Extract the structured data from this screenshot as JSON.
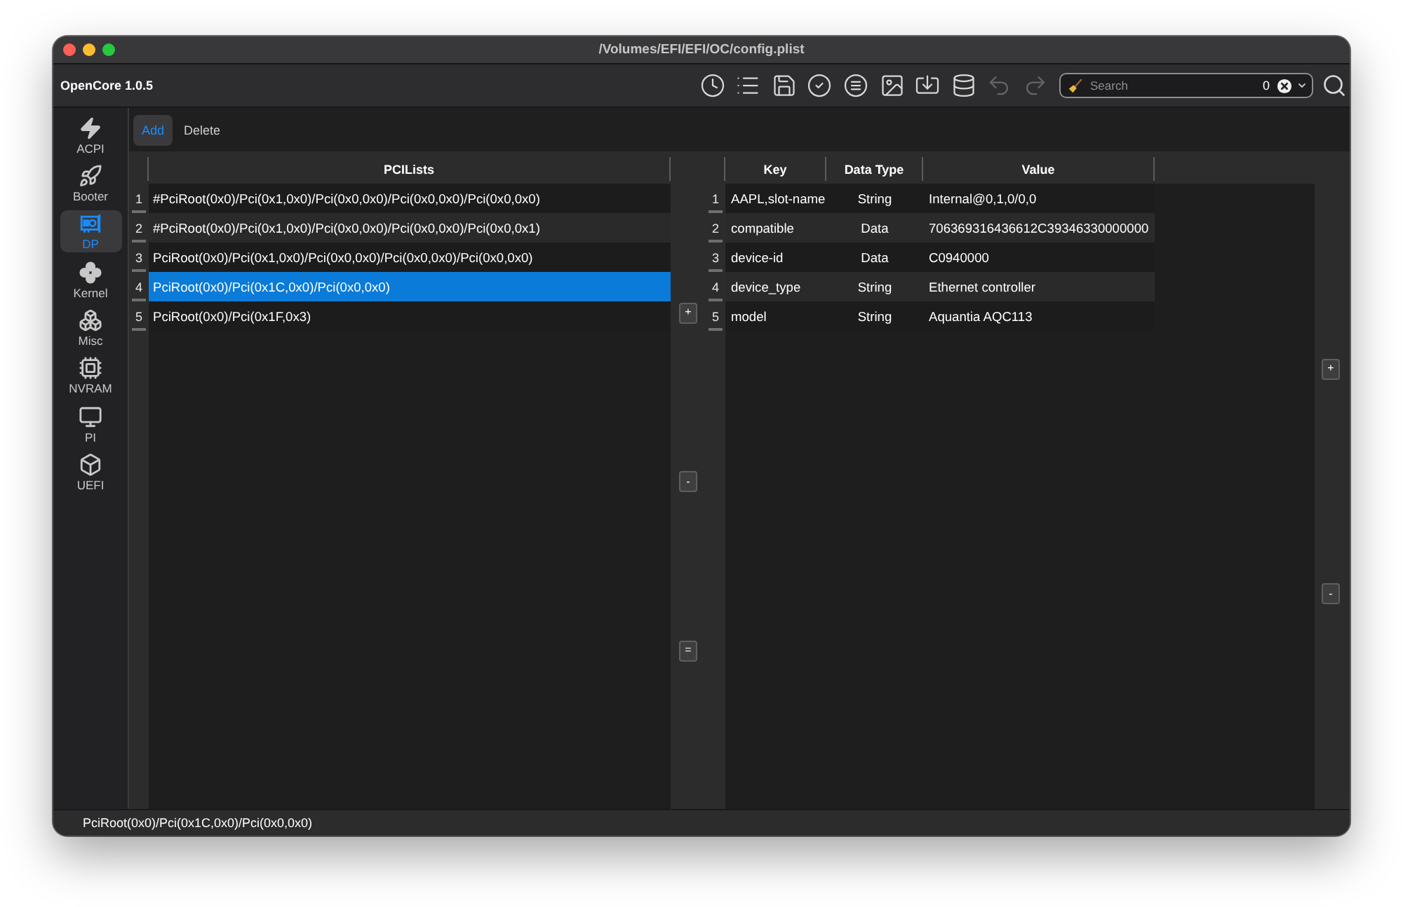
{
  "window": {
    "title": "/Volumes/EFI/EFI/OC/config.plist"
  },
  "toolbar": {
    "app_label": "OpenCore 1.0.5",
    "buttons": [
      {
        "disabled": false
      },
      {
        "disabled": false
      },
      {
        "disabled": false
      },
      {
        "disabled": false
      },
      {
        "disabled": false
      },
      {
        "disabled": false
      },
      {
        "disabled": false
      },
      {
        "disabled": false
      },
      {
        "disabled": true
      },
      {
        "disabled": true
      }
    ],
    "search": {
      "placeholder": "Search",
      "count": "0"
    }
  },
  "sidebar": {
    "items": [
      {
        "label": "ACPI",
        "selected": false
      },
      {
        "label": "Booter",
        "selected": false
      },
      {
        "label": "DP",
        "selected": true
      },
      {
        "label": "Kernel",
        "selected": false
      },
      {
        "label": "Misc",
        "selected": false
      },
      {
        "label": "NVRAM",
        "selected": false
      },
      {
        "label": "PI",
        "selected": false
      },
      {
        "label": "UEFI",
        "selected": false
      }
    ]
  },
  "section_tabs": [
    {
      "label": "Add",
      "selected": true
    },
    {
      "label": "Delete",
      "selected": false
    }
  ],
  "pci_list": {
    "header": "PCILists",
    "rows": [
      {
        "number": "1",
        "path": "#PciRoot(0x0)/Pci(0x1,0x0)/Pci(0x0,0x0)/Pci(0x0,0x0)/Pci(0x0,0x0)",
        "selected": false
      },
      {
        "number": "2",
        "path": "#PciRoot(0x0)/Pci(0x1,0x0)/Pci(0x0,0x0)/Pci(0x0,0x0)/Pci(0x0,0x1)",
        "selected": false
      },
      {
        "number": "3",
        "path": "PciRoot(0x0)/Pci(0x1,0x0)/Pci(0x0,0x0)/Pci(0x0,0x0)/Pci(0x0,0x0)",
        "selected": false
      },
      {
        "number": "4",
        "path": "PciRoot(0x0)/Pci(0x1C,0x0)/Pci(0x0,0x0)",
        "selected": true
      },
      {
        "number": "5",
        "path": "PciRoot(0x0)/Pci(0x1F,0x3)",
        "selected": false
      }
    ]
  },
  "move_buttons": [
    "+",
    "-",
    "="
  ],
  "properties": {
    "columns": [
      "Key",
      "Data Type",
      "Value"
    ],
    "rows": [
      {
        "number": "1",
        "key": "AAPL,slot-name",
        "data_type": "String",
        "value": "Internal@0,1,0/0,0"
      },
      {
        "number": "2",
        "key": "compatible",
        "data_type": "Data",
        "value": "706369316436612C39346330000000"
      },
      {
        "number": "3",
        "key": "device-id",
        "data_type": "Data",
        "value": "C0940000"
      },
      {
        "number": "4",
        "key": "device_type",
        "data_type": "String",
        "value": "Ethernet controller"
      },
      {
        "number": "5",
        "key": "model",
        "data_type": "String",
        "value": "Aquantia AQC113"
      }
    ]
  },
  "property_buttons": [
    "+",
    "-"
  ],
  "status_bar": {
    "text": "PciRoot(0x0)/Pci(0x1C,0x0)/Pci(0x0,0x0)"
  }
}
